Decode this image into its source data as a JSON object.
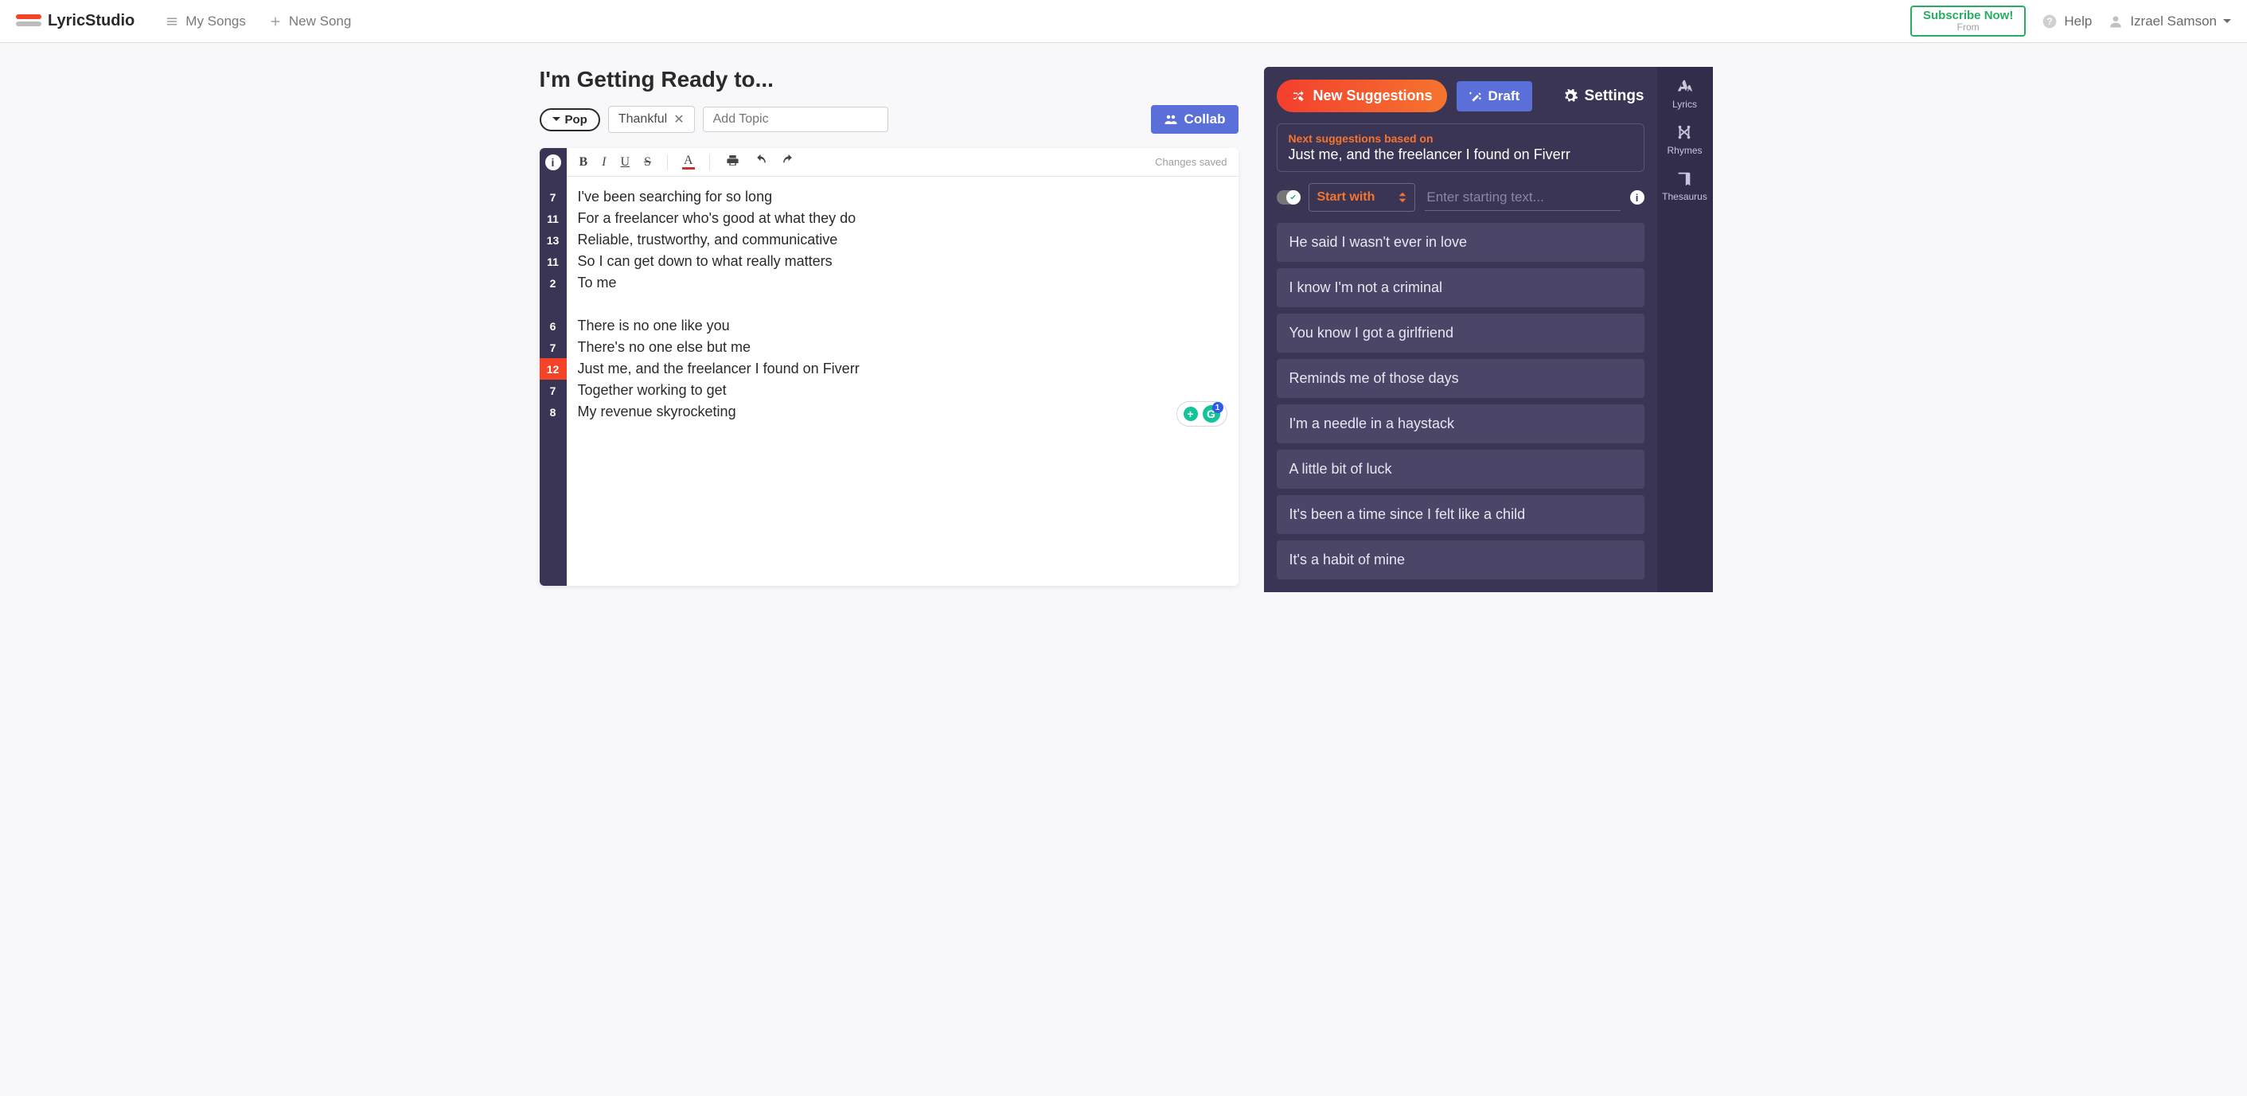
{
  "header": {
    "brand": "LyricStudio",
    "nav": {
      "my_songs": "My Songs",
      "new_song": "New Song"
    },
    "subscribe": {
      "line1": "Subscribe Now!",
      "line2": "From"
    },
    "help": "Help",
    "user_name": "Izrael Samson"
  },
  "song": {
    "title": "I'm Getting Ready to...",
    "genre": "Pop",
    "topics": [
      "Thankful"
    ],
    "add_topic_placeholder": "Add Topic",
    "collab_label": "Collab",
    "save_status": "Changes saved"
  },
  "lyrics": {
    "lines": [
      {
        "count": "7",
        "text": "I've been searching for so long",
        "highlight": false
      },
      {
        "count": "11",
        "text": "For a freelancer who's good at what they do",
        "highlight": false
      },
      {
        "count": "13",
        "text": "Reliable, trustworthy, and communicative",
        "highlight": false
      },
      {
        "count": "11",
        "text": "So I can get down to what really matters",
        "highlight": false
      },
      {
        "count": "2",
        "text": "To me",
        "highlight": false
      },
      {
        "count": "",
        "text": "",
        "highlight": false
      },
      {
        "count": "6",
        "text": "There is no one like you",
        "highlight": false
      },
      {
        "count": "7",
        "text": "There's no one else but me",
        "highlight": false
      },
      {
        "count": "12",
        "text": "Just me, and the freelancer I found on Fiverr",
        "highlight": true
      },
      {
        "count": "7",
        "text": "Together working to get",
        "highlight": false
      },
      {
        "count": "8",
        "text": "My revenue skyrocketing",
        "highlight": false
      }
    ],
    "grammarly_badge": "1"
  },
  "panel": {
    "new_suggestions": "New Suggestions",
    "draft": "Draft",
    "settings": "Settings",
    "context_label": "Next suggestions based on",
    "context_line": "Just me, and the freelancer I found on Fiverr",
    "start_mode": "Start with",
    "start_placeholder": "Enter starting text...",
    "suggestions": [
      "He said I wasn't ever in love",
      "I know I'm not a criminal",
      "You know I got a girlfriend",
      "Reminds me of those days",
      "I'm a needle in a haystack",
      "A little bit of luck",
      "It's been a time since I felt like a child",
      "It's a habit of mine"
    ],
    "side": {
      "lyrics": "Lyrics",
      "rhymes": "Rhymes",
      "thesaurus": "Thesaurus"
    }
  }
}
